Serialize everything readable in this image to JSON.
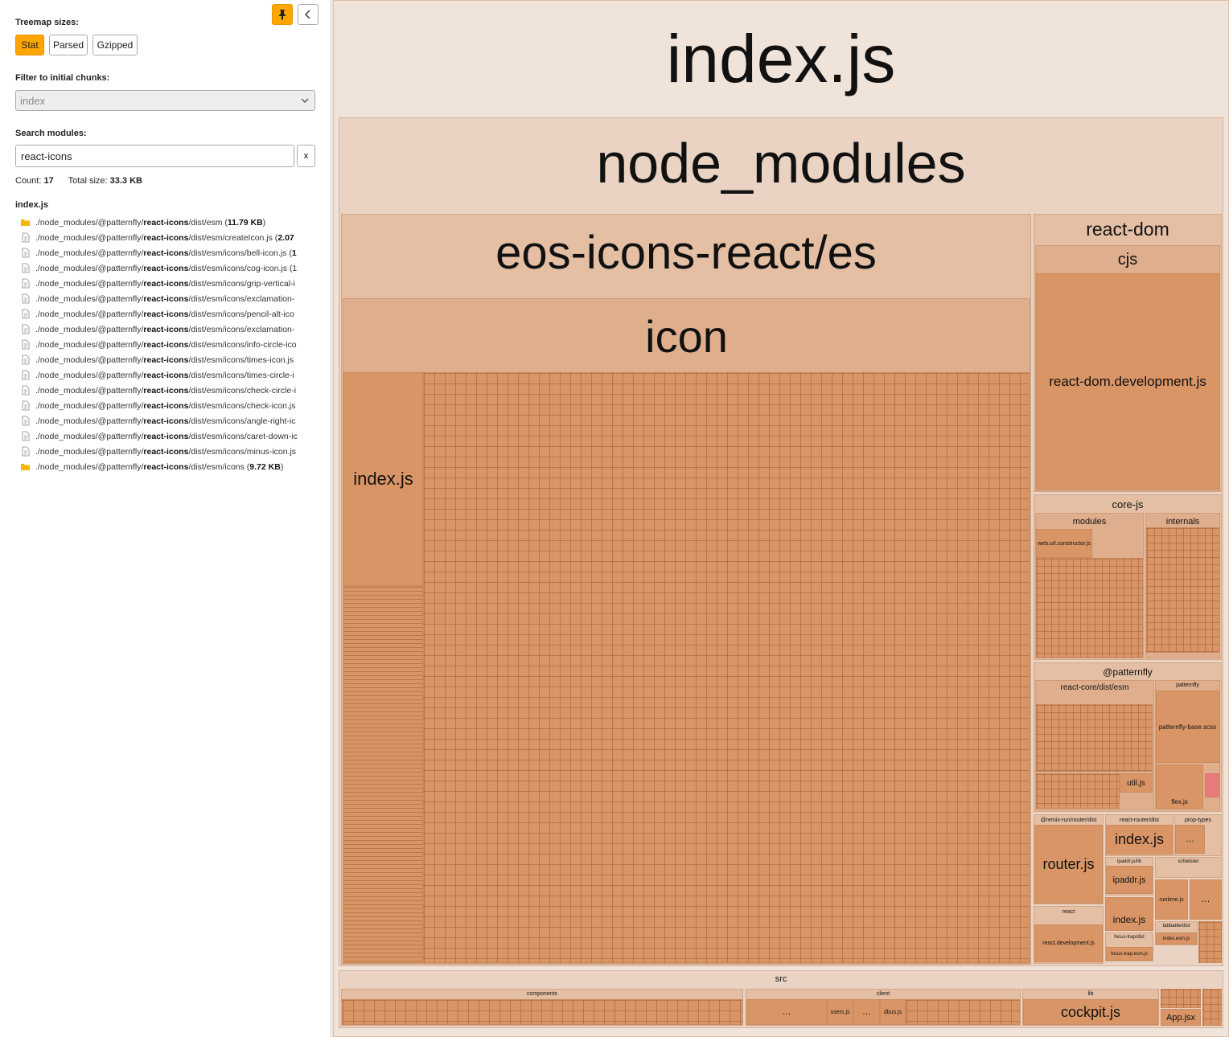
{
  "sidebar": {
    "treemap_sizes_label": "Treemap sizes:",
    "size_buttons": [
      "Stat",
      "Parsed",
      "Gzipped"
    ],
    "active_size": "Stat",
    "filter_label": "Filter to initial chunks:",
    "filter_value": "index",
    "search_label": "Search modules:",
    "search_value": "react-icons",
    "clear_label": "x",
    "count_label": "Count:",
    "count_value": "17",
    "total_label": "Total size:",
    "total_value": "33.3 KB",
    "chunk_name": "index.js",
    "modules": [
      {
        "type": "folder",
        "pre": "./node_modules/@patternfly/",
        "hl": "react-icons",
        "post": "/dist/esm (",
        "size": "11.79 KB",
        "end": ")"
      },
      {
        "type": "file",
        "pre": "./node_modules/@patternfly/",
        "hl": "react-icons",
        "post": "/dist/esm/createIcon.js (",
        "size": "2.07",
        "end": ""
      },
      {
        "type": "file",
        "pre": "./node_modules/@patternfly/",
        "hl": "react-icons",
        "post": "/dist/esm/icons/bell-icon.js (",
        "size": "1",
        "end": ""
      },
      {
        "type": "file",
        "pre": "./node_modules/@patternfly/",
        "hl": "react-icons",
        "post": "/dist/esm/icons/cog-icon.js (1",
        "size": "",
        "end": ""
      },
      {
        "type": "file",
        "pre": "./node_modules/@patternfly/",
        "hl": "react-icons",
        "post": "/dist/esm/icons/grip-vertical-i",
        "size": "",
        "end": ""
      },
      {
        "type": "file",
        "pre": "./node_modules/@patternfly/",
        "hl": "react-icons",
        "post": "/dist/esm/icons/exclamation-",
        "size": "",
        "end": ""
      },
      {
        "type": "file",
        "pre": "./node_modules/@patternfly/",
        "hl": "react-icons",
        "post": "/dist/esm/icons/pencil-alt-ico",
        "size": "",
        "end": ""
      },
      {
        "type": "file",
        "pre": "./node_modules/@patternfly/",
        "hl": "react-icons",
        "post": "/dist/esm/icons/exclamation-",
        "size": "",
        "end": ""
      },
      {
        "type": "file",
        "pre": "./node_modules/@patternfly/",
        "hl": "react-icons",
        "post": "/dist/esm/icons/info-circle-ico",
        "size": "",
        "end": ""
      },
      {
        "type": "file",
        "pre": "./node_modules/@patternfly/",
        "hl": "react-icons",
        "post": "/dist/esm/icons/times-icon.js",
        "size": "",
        "end": ""
      },
      {
        "type": "file",
        "pre": "./node_modules/@patternfly/",
        "hl": "react-icons",
        "post": "/dist/esm/icons/times-circle-i",
        "size": "",
        "end": ""
      },
      {
        "type": "file",
        "pre": "./node_modules/@patternfly/",
        "hl": "react-icons",
        "post": "/dist/esm/icons/check-circle-i",
        "size": "",
        "end": ""
      },
      {
        "type": "file",
        "pre": "./node_modules/@patternfly/",
        "hl": "react-icons",
        "post": "/dist/esm/icons/check-icon.js",
        "size": "",
        "end": ""
      },
      {
        "type": "file",
        "pre": "./node_modules/@patternfly/",
        "hl": "react-icons",
        "post": "/dist/esm/icons/angle-right-ic",
        "size": "",
        "end": ""
      },
      {
        "type": "file",
        "pre": "./node_modules/@patternfly/",
        "hl": "react-icons",
        "post": "/dist/esm/icons/caret-down-ic",
        "size": "",
        "end": ""
      },
      {
        "type": "file",
        "pre": "./node_modules/@patternfly/",
        "hl": "react-icons",
        "post": "/dist/esm/icons/minus-icon.js",
        "size": "",
        "end": ""
      },
      {
        "type": "folder",
        "pre": "./node_modules/@patternfly/",
        "hl": "react-icons",
        "post": "/dist/esm/icons (",
        "size": "9.72 KB",
        "end": ")"
      }
    ]
  },
  "treemap": {
    "labels": {
      "root": "index.js",
      "node_modules": "node_modules",
      "eos": "eos-icons-react/es",
      "icon": "icon",
      "icon_index": "index.js",
      "react_dom": "react-dom",
      "cjs": "cjs",
      "react_dom_dev": "react-dom.development.js",
      "core_js": "core-js",
      "modules": "modules",
      "internals": "internals",
      "web_url": "web.url.constructor.js",
      "patternfly": "@patternfly",
      "react_core": "react-core/dist/esm",
      "patternfly_sub": "patternfly",
      "pf_base": "patternfly-base.scss",
      "util": "util.js",
      "flex": "flex.js",
      "remix": "@remix-run/router/dist",
      "router": "router.js",
      "react_router": "react-router/dist",
      "rr_index": "index.js",
      "prop_types": "prop-types",
      "ipaddr_lib": "ipaddr.js/lib",
      "ipaddr": "ipaddr.js",
      "scheduler": "scheduler",
      "runtime": "runtime.js",
      "react": "react",
      "react_dev": "react.development.js",
      "small_index": "index.js",
      "focus_trap_dist": "focus-trap/dist",
      "focus_trap": "focus-trap.esm.js",
      "tabbable_dist": "tabbable/dist",
      "index_esm": "index.esm.js",
      "src": "src",
      "components": "components",
      "client": "client",
      "users": "users.js",
      "dbus": "dbus.js",
      "lib": "lib",
      "cockpit": "cockpit.js",
      "app": "App.jsx",
      "ellipsis": "…"
    }
  },
  "colors": {
    "accent": "#ffa500",
    "tile": "#d99566"
  }
}
